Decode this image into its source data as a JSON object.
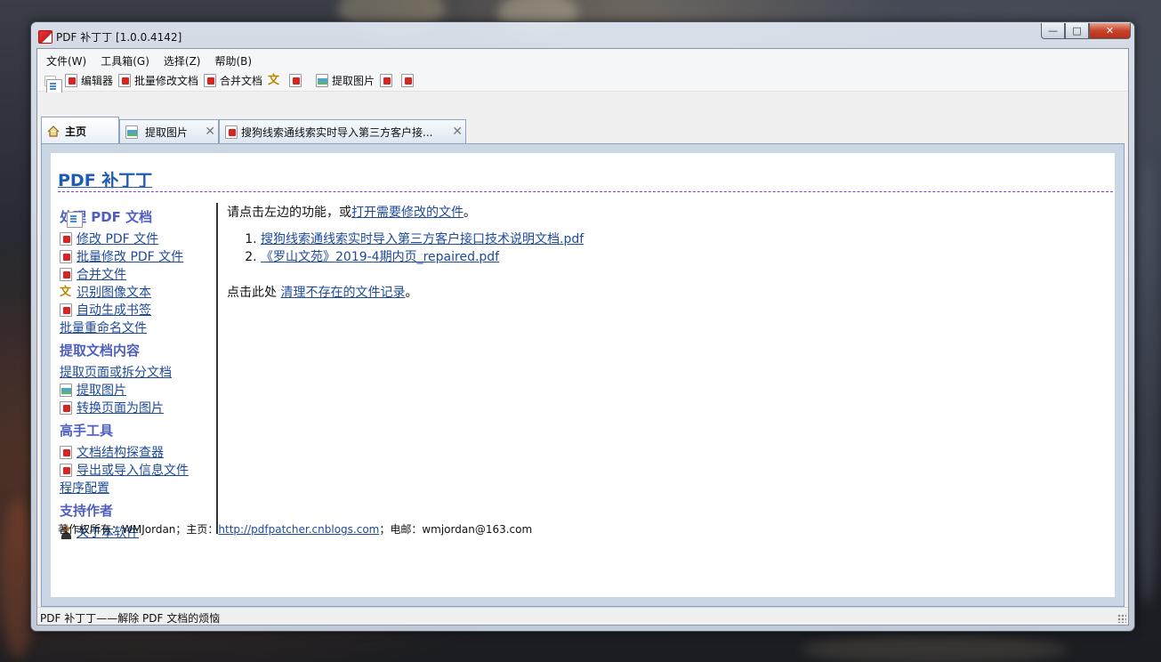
{
  "window": {
    "title": "PDF 补丁丁 [1.0.0.4142]",
    "min": "—",
    "max": "□",
    "close": "✕"
  },
  "menubar": {
    "items": [
      {
        "label": "文件(W)"
      },
      {
        "label": "工具箱(G)"
      },
      {
        "label": "选择(Z)"
      },
      {
        "label": "帮助(B)"
      }
    ]
  },
  "toolbar": {
    "editor": "编辑器",
    "batch_modify": "批量修改文档",
    "merge": "合并文档",
    "extract_images": "提取图片"
  },
  "tabs": [
    {
      "label": "主页",
      "icon": "home-icon"
    },
    {
      "label": "提取图片",
      "icon": "image-icon"
    },
    {
      "label": "搜狗线索通线索实时导入第三方客户接...",
      "icon": "pdf-icon"
    }
  ],
  "page": {
    "title": "PDF 补丁丁",
    "sections": [
      {
        "heading": "处理 PDF 文档",
        "links": [
          {
            "label": "修改 PDF 文件",
            "icon": "pdf-icon"
          },
          {
            "label": "批量修改 PDF 文件",
            "icon": "pdf-batch-icon"
          },
          {
            "label": "合并文件",
            "icon": "merge-icon"
          },
          {
            "label": "识别图像文本",
            "icon": "ocr-icon"
          },
          {
            "label": "自动生成书签",
            "icon": "bookmark-icon"
          },
          {
            "label": "批量重命名文件",
            "icon": "rename-icon"
          }
        ]
      },
      {
        "heading": "提取文档内容",
        "links": [
          {
            "label": "提取页面或拆分文档",
            "icon": "extract-pages-icon"
          },
          {
            "label": "提取图片",
            "icon": "image-icon"
          },
          {
            "label": "转换页面为图片",
            "icon": "convert-icon"
          }
        ]
      },
      {
        "heading": "高手工具",
        "links": [
          {
            "label": "文档结构探查器",
            "icon": "inspector-icon"
          },
          {
            "label": "导出或导入信息文件",
            "icon": "export-icon"
          },
          {
            "label": "程序配置",
            "icon": "config-icon"
          }
        ]
      },
      {
        "heading": "支持作者",
        "links": [
          {
            "label": "关于本软件",
            "icon": "user-icon"
          }
        ]
      }
    ],
    "main": {
      "intro_prefix": "请点击左边的功能，或",
      "intro_link": "打开需要修改的文件",
      "intro_suffix": "。",
      "recent_files": [
        "搜狗线索通线索实时导入第三方客户接口技术说明文档.pdf",
        "《罗山文苑》2019-4期内页_repaired.pdf"
      ],
      "clean_prefix": "点击此处",
      "clean_link": "清理不存在的文件记录",
      "clean_suffix": "。"
    },
    "footer": {
      "prefix": "著作权所有：WMJordan；主页：",
      "link": "http://pdfpatcher.cnblogs.com",
      "suffix": "；电邮：wmjordan@163.com"
    }
  },
  "statusbar": {
    "text": "PDF 补丁丁——解除 PDF 文档的烦恼"
  }
}
